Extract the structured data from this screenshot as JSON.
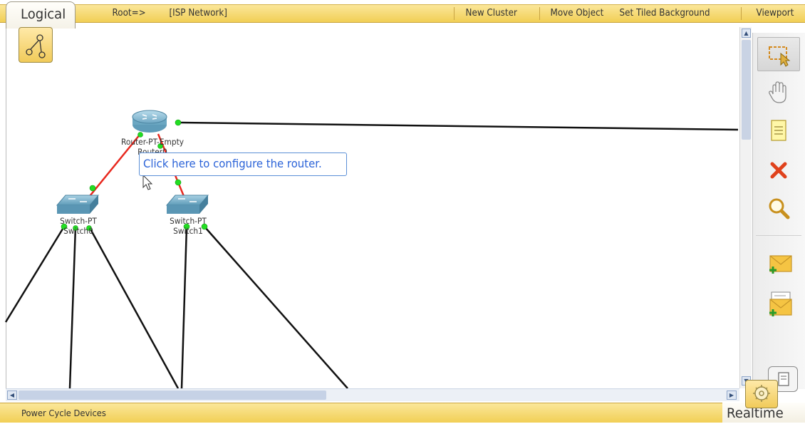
{
  "top_bar": {
    "mode": "Logical",
    "root": "Root=>",
    "cluster_path": "[ISP Network]",
    "new_cluster": "New Cluster",
    "move_object": "Move Object",
    "set_tiled_background": "Set Tiled Background",
    "viewport": "Viewport"
  },
  "devices": {
    "router": {
      "line1": "Router-PT-Empty",
      "line2": "Router0",
      "icon": "router-icon"
    },
    "switch0": {
      "line1": "Switch-PT",
      "line2": "Switch0",
      "icon": "switch-icon"
    },
    "switch1": {
      "line1": "Switch-PT",
      "line2": "Switch1",
      "icon": "switch-icon"
    }
  },
  "tooltip": {
    "text": "Click here to configure the router."
  },
  "toolbar": {
    "tools": [
      "select-icon",
      "hand-move-icon",
      "note-icon",
      "delete-icon",
      "inspect-zoom-icon",
      "add-simple-pdu-icon",
      "add-complex-pdu-icon"
    ]
  },
  "bottom_bar": {
    "power_cycle": "Power Cycle Devices",
    "mode": "Realtime"
  },
  "colors": {
    "bar_yellow": "#f1cf55",
    "link_black": "#111111",
    "link_red": "#e8281e",
    "port_green": "#22dd22",
    "tooltip_blue": "#2b63d8"
  }
}
